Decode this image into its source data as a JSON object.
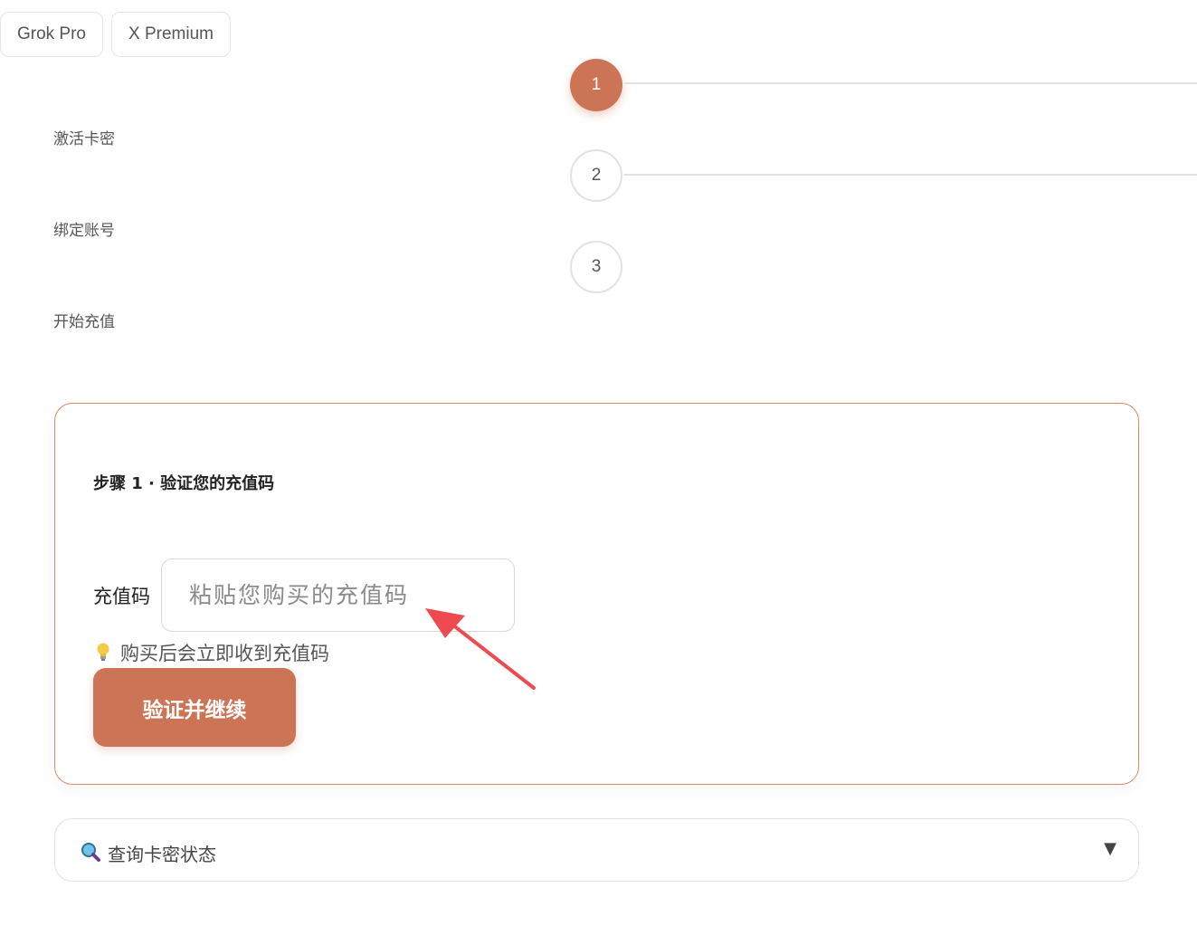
{
  "tabs": [
    {
      "label": "Grok Pro"
    },
    {
      "label": "X Premium"
    }
  ],
  "steps": [
    {
      "number": "1",
      "label": "激活卡密",
      "state": "active"
    },
    {
      "number": "2",
      "label": "绑定账号",
      "state": "inactive"
    },
    {
      "number": "3",
      "label": "开始充值",
      "state": "inactive"
    }
  ],
  "card": {
    "title": "步骤 1 · 验证您的充值码",
    "code_label": "充值码",
    "code_value": "",
    "code_placeholder": "粘贴您购买的充值码",
    "hint_icon": "lightbulb-icon",
    "hint": "购买后会立即收到充值码",
    "verify_button": "验证并继续"
  },
  "status_query": {
    "icon": "magnifier-icon",
    "label": "查询卡密状态",
    "expand_icon": "triangle-down-icon"
  },
  "colors": {
    "accent": "#cc7556",
    "card_border": "#d9876a",
    "annotation_arrow": "#ee4a4f"
  }
}
